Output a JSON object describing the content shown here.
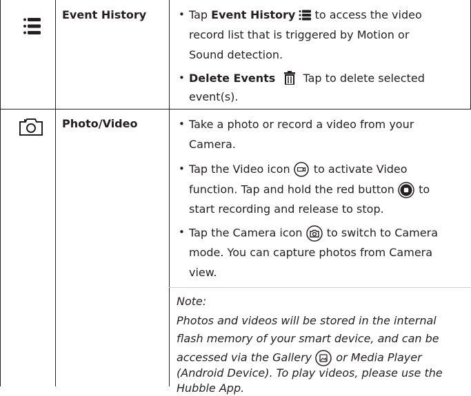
{
  "rows": [
    {
      "icon": "list-icon",
      "label": "Event History",
      "bullets": [
        {
          "lines": [
            {
              "parts": [
                {
                  "t": "Tap "
                },
                {
                  "t": "Event History",
                  "b": true
                },
                {
                  "icon": "list-icon"
                },
                {
                  "t": " to access the video"
                }
              ]
            },
            {
              "parts": [
                {
                  "t": "record list that is triggered by Motion or"
                }
              ]
            },
            {
              "parts": [
                {
                  "t": "Sound detection."
                }
              ]
            }
          ]
        },
        {
          "lines": [
            {
              "parts": [
                {
                  "t": "Delete Events",
                  "b": true
                },
                {
                  "icon": "trash-icon"
                },
                {
                  "t": " Tap to delete selected"
                }
              ]
            },
            {
              "parts": [
                {
                  "t": "event(s)."
                }
              ]
            }
          ]
        }
      ]
    },
    {
      "icon": "camera-icon",
      "label": "Photo/Video",
      "bullets": [
        {
          "lines": [
            {
              "parts": [
                {
                  "t": "Take a photo or record a video from your"
                }
              ]
            },
            {
              "parts": [
                {
                  "t": "Camera."
                }
              ]
            }
          ]
        },
        {
          "lines": [
            {
              "parts": [
                {
                  "t": "Tap the Video icon "
                },
                {
                  "icon": "video-icon"
                },
                {
                  "t": " to activate Video"
                }
              ]
            },
            {
              "parts": [
                {
                  "t": "function. Tap and hold the red button "
                },
                {
                  "icon": "record-button-icon"
                },
                {
                  "t": " to"
                }
              ]
            },
            {
              "parts": [
                {
                  "t": "start recording and release to stop."
                }
              ]
            }
          ]
        },
        {
          "lines": [
            {
              "parts": [
                {
                  "t": "Tap the Camera icon "
                },
                {
                  "icon": "camera-mode-icon"
                },
                {
                  "t": " to switch to Camera"
                }
              ]
            },
            {
              "parts": [
                {
                  "t": "mode. You can capture photos from Camera"
                }
              ]
            },
            {
              "parts": [
                {
                  "t": "view."
                }
              ]
            }
          ]
        }
      ],
      "note": {
        "title": "Note:",
        "lines": [
          {
            "parts": [
              {
                "t": "Photos and videos will be stored in the internal"
              }
            ]
          },
          {
            "parts": [
              {
                "t": "flash memory of your smart device, and can be"
              }
            ]
          },
          {
            "parts": [
              {
                "t": "accessed via the Gallery "
              },
              {
                "icon": "gallery-icon"
              },
              {
                "t": " or Media Player"
              }
            ]
          },
          {
            "parts": [
              {
                "t": "(Android Device). To play videos, please use the"
              }
            ]
          },
          {
            "parts": [
              {
                "t": "Hubble App."
              }
            ]
          }
        ]
      }
    }
  ]
}
